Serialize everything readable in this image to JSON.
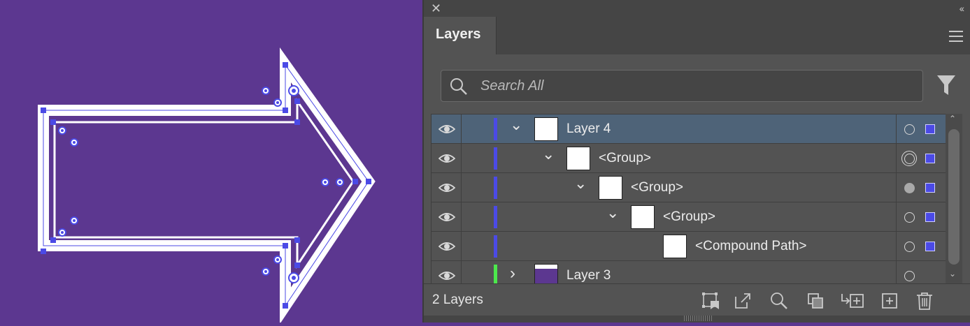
{
  "panel": {
    "tab_label": "Layers",
    "search_placeholder": "Search All",
    "footer_count": "2 Layers"
  },
  "layers": [
    {
      "name": "Layer 4",
      "level": 0,
      "expanded": true,
      "selected": true,
      "color": "#4b4ae6",
      "target": "hollow",
      "thumb": "white"
    },
    {
      "name": "<Group>",
      "level": 1,
      "expanded": true,
      "selected": false,
      "color": "#4b4ae6",
      "target": "double",
      "thumb": "white"
    },
    {
      "name": "<Group>",
      "level": 2,
      "expanded": true,
      "selected": false,
      "color": "#4b4ae6",
      "target": "filled",
      "thumb": "white"
    },
    {
      "name": "<Group>",
      "level": 3,
      "expanded": true,
      "selected": false,
      "color": "#4b4ae6",
      "target": "hollow",
      "thumb": "white"
    },
    {
      "name": "<Compound Path>",
      "level": 4,
      "expanded": null,
      "selected": false,
      "color": "#4b4ae6",
      "target": "hollow",
      "thumb": "white"
    },
    {
      "name": "Layer 3",
      "level": 0,
      "expanded": false,
      "selected": false,
      "color": "#4ce84c",
      "target": "hollow",
      "thumb": "purple"
    }
  ],
  "toolbar_icons": [
    "collect-for-export-icon",
    "export-icon",
    "locate-object-icon",
    "clipping-mask-icon",
    "create-sublayer-icon",
    "new-layer-icon",
    "delete-icon"
  ],
  "colors": {
    "artboard": "#5c3790",
    "selection": "#4b4ae6",
    "layer4_color": "#4b4ae6",
    "layer3_color": "#4ce84c"
  }
}
